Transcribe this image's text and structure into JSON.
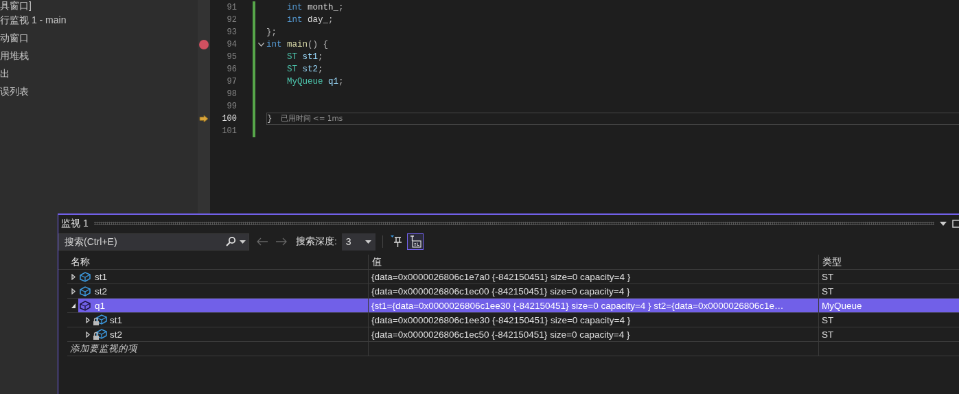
{
  "sidebar": {
    "items": [
      {
        "label": "具窗口]"
      },
      {
        "label": "行监视 1 - main"
      },
      {
        "label": "动窗口"
      },
      {
        "label": "用堆栈"
      },
      {
        "label": "出"
      },
      {
        "label": "误列表"
      }
    ]
  },
  "editor": {
    "lines": [
      {
        "number": "91",
        "breakpoint": false,
        "current": false,
        "tokens": [
          {
            "kind": "keyword",
            "text": "    int"
          },
          {
            "kind": "field",
            "text": " month_"
          },
          {
            "kind": "punct",
            "text": ";"
          }
        ]
      },
      {
        "number": "92",
        "breakpoint": false,
        "current": false,
        "tokens": [
          {
            "kind": "keyword",
            "text": "    int"
          },
          {
            "kind": "field",
            "text": " day_"
          },
          {
            "kind": "punct",
            "text": ";"
          }
        ]
      },
      {
        "number": "93",
        "breakpoint": false,
        "current": false,
        "tokens": [
          {
            "kind": "punct",
            "text": "};"
          }
        ]
      },
      {
        "number": "94",
        "breakpoint": true,
        "current": false,
        "foldable": true,
        "tokens": [
          {
            "kind": "keyword",
            "text": "int"
          },
          {
            "kind": "function",
            "text": " main"
          },
          {
            "kind": "punct",
            "text": "() {"
          }
        ]
      },
      {
        "number": "95",
        "breakpoint": false,
        "current": false,
        "tokens": [
          {
            "kind": "type",
            "text": "    ST"
          },
          {
            "kind": "variable",
            "text": " st1"
          },
          {
            "kind": "punct",
            "text": ";"
          }
        ]
      },
      {
        "number": "96",
        "breakpoint": false,
        "current": false,
        "tokens": [
          {
            "kind": "type",
            "text": "    ST"
          },
          {
            "kind": "variable",
            "text": " st2"
          },
          {
            "kind": "punct",
            "text": ";"
          }
        ]
      },
      {
        "number": "97",
        "breakpoint": false,
        "current": false,
        "tokens": [
          {
            "kind": "type",
            "text": "    MyQueue"
          },
          {
            "kind": "variable",
            "text": " q1"
          },
          {
            "kind": "punct",
            "text": ";"
          }
        ]
      },
      {
        "number": "98",
        "breakpoint": false,
        "current": false
      },
      {
        "number": "99",
        "breakpoint": false,
        "current": false
      },
      {
        "number": "100",
        "breakpoint": false,
        "current": true,
        "tokens": [
          {
            "kind": "punct",
            "text": "}"
          }
        ],
        "hint": "已用时间 <= 1ms"
      },
      {
        "number": "101",
        "breakpoint": false,
        "current": false
      }
    ]
  },
  "watch": {
    "title": "监视 1",
    "search": {
      "placeholder": "搜索(Ctrl+E)"
    },
    "depth_label": "搜索深度:",
    "depth": "3",
    "toolbar_buttons": [
      {
        "kind": "pin",
        "selected": false
      },
      {
        "kind": "raw",
        "selected": true
      }
    ],
    "columns": [
      "名称",
      "值",
      "类型"
    ],
    "rows": [
      {
        "name": "st1",
        "value": "{data=0x0000026806c1e7a0 {-842150451} size=0 capacity=4 }",
        "type": "ST",
        "kind": "struct",
        "expanded": false,
        "selected": false
      },
      {
        "name": "st2",
        "value": "{data=0x0000026806c1ec00 {-842150451} size=0 capacity=4 }",
        "type": "ST",
        "kind": "struct",
        "expanded": false,
        "selected": false
      },
      {
        "name": "q1",
        "value": "{st1={data=0x0000026806c1ee30 {-842150451} size=0 capacity=4 } st2={data=0x0000026806c1e…",
        "type": "MyQueue",
        "kind": "struct",
        "expanded": true,
        "selected": true,
        "children": [
          {
            "name": "st1",
            "value": "{data=0x0000026806c1ee30 {-842150451} size=0 capacity=4 }",
            "type": "ST",
            "kind": "private",
            "expanded": false,
            "selected": false
          },
          {
            "name": "st2",
            "value": "{data=0x0000026806c1ec50 {-842150451} size=0 capacity=4 }",
            "type": "ST",
            "kind": "private",
            "expanded": false,
            "selected": false
          }
        ]
      }
    ],
    "add_placeholder": "添加要监视的项"
  }
}
